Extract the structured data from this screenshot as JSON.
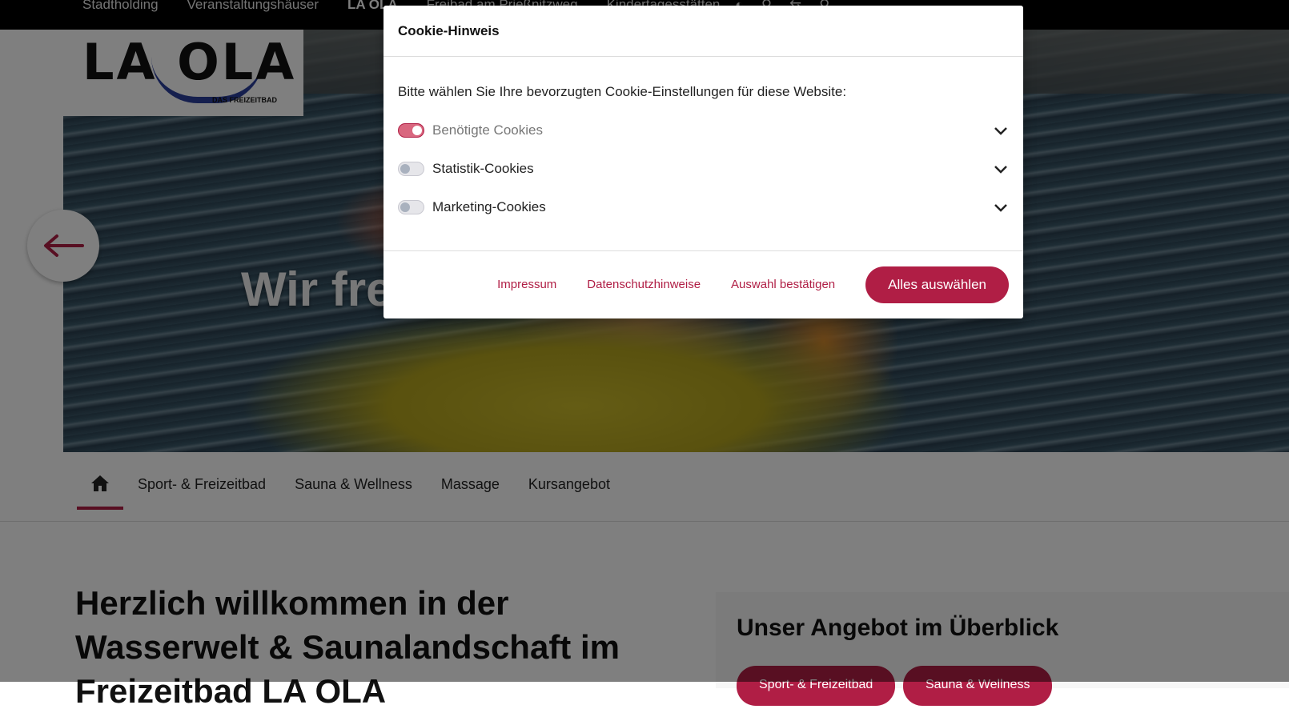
{
  "top_nav": {
    "items": [
      "Stadtholding",
      "Veranstaltungshäuser",
      "LA OLA",
      "Freibad am Prießnitzweg",
      "Kindertagesstätten"
    ],
    "active_index": 2,
    "icons": [
      "contrast-icon",
      "accessibility-icon",
      "language-icon",
      "search-icon"
    ]
  },
  "logo": {
    "text": "LA OLA",
    "sub": "DAS FREIZEITBAD"
  },
  "hero": {
    "title": "Wir freuen",
    "slides": 2,
    "active_slide": 1
  },
  "sub_nav": {
    "links": [
      "Sport- & Freizeitbad",
      "Sauna & Wellness",
      "Massage",
      "Kursangebot"
    ]
  },
  "welcome": {
    "title_line1": "Herzlich willkommen in der",
    "title_line2": "Wasserwelt & Saunalandschaft im",
    "title_line3": "Freizeitbad LA OLA"
  },
  "offer": {
    "title": "Unser Angebot im Überblick",
    "pills": [
      "Sport- & Freizeitbad",
      "Sauna & Wellness"
    ]
  },
  "cookie_modal": {
    "title": "Cookie-Hinweis",
    "intro": "Bitte wählen Sie Ihre bevorzugten Cookie-Einstellungen für diese Website:",
    "options": [
      {
        "label": "Benötigte Cookies",
        "on": true,
        "disabled": true
      },
      {
        "label": "Statistik-Cookies",
        "on": false,
        "disabled": false
      },
      {
        "label": "Marketing-Cookies",
        "on": false,
        "disabled": false
      }
    ],
    "footer": {
      "impressum": "Impressum",
      "privacy": "Datenschutzhinweise",
      "confirm": "Auswahl bestätigen",
      "accept_all": "Alles auswählen"
    }
  },
  "colors": {
    "accent": "#b01e45",
    "topbar": "#000000"
  }
}
